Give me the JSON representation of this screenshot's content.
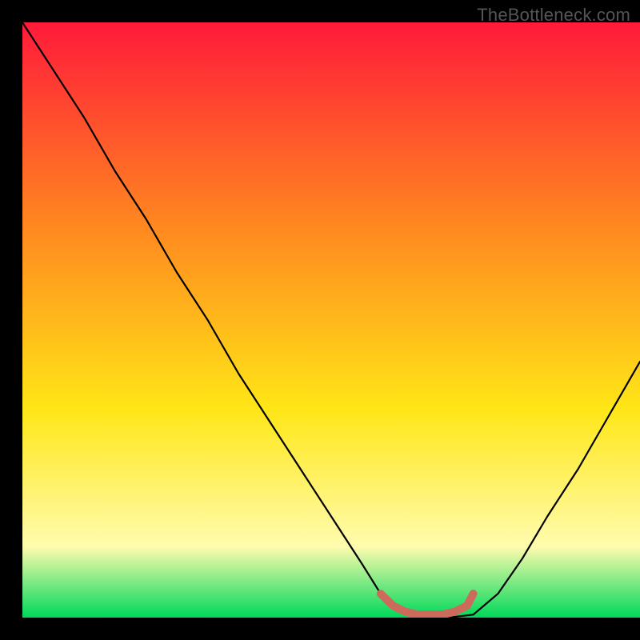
{
  "watermark": "TheBottleneck.com",
  "colors": {
    "bg": "#000000",
    "grad_top": "#ff1a3a",
    "grad_mid1": "#ff8a1f",
    "grad_mid2": "#ffe617",
    "grad_low": "#fffcae",
    "grad_bottom": "#00d85a",
    "curve": "#000000",
    "arc": "#cc6a5c"
  },
  "chart_data": {
    "type": "line",
    "title": "",
    "xlabel": "",
    "ylabel": "",
    "xlim": [
      0,
      100
    ],
    "ylim": [
      0,
      100
    ],
    "series": [
      {
        "name": "curve",
        "x": [
          0,
          5,
          10,
          15,
          20,
          25,
          30,
          35,
          40,
          45,
          50,
          55,
          58,
          63,
          66,
          69,
          73,
          77,
          81,
          85,
          90,
          95,
          100
        ],
        "y": [
          100,
          92,
          84,
          75,
          67,
          58,
          50,
          41,
          33,
          25,
          17,
          9,
          4,
          0.5,
          0,
          0,
          0.5,
          4,
          10,
          17,
          25,
          34,
          43
        ]
      },
      {
        "name": "arc-marker",
        "x": [
          58,
          60,
          62,
          64,
          66,
          68,
          70,
          72,
          73
        ],
        "y": [
          4,
          2,
          1,
          0.5,
          0.5,
          0.5,
          1,
          2,
          4
        ]
      }
    ]
  }
}
